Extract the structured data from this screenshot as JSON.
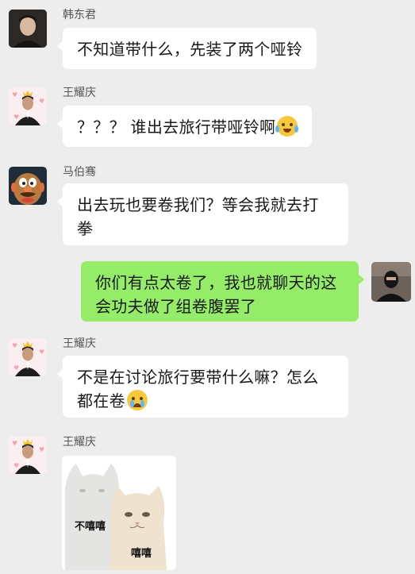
{
  "messages": [
    {
      "sender": "韩东君",
      "text": "不知道带什么，先装了两个哑铃",
      "avatar_icon": "man-portrait-avatar"
    },
    {
      "sender": "王耀庆",
      "text": "？？？ 谁出去旅行带哑铃啊",
      "emoji": "crying-laughing-emoji",
      "avatar_icon": "man-with-crown-avatar"
    },
    {
      "sender": "马伯骞",
      "line1": "出去玩也要卷我们？等会我就去打",
      "line2": "拳",
      "avatar_icon": "potato-head-avatar"
    },
    {
      "sender": "me",
      "line1": "你们有点太卷了，我也就聊天的这",
      "line2": "会功夫做了组卷腹罢了",
      "avatar_icon": "masked-person-avatar"
    },
    {
      "sender": "王耀庆",
      "line1": "不是在讨论旅行要带什么嘛？怎么",
      "line2": "都在卷",
      "emoji": "crying-emoji",
      "avatar_icon": "man-with-crown-avatar"
    },
    {
      "sender": "王耀庆",
      "sticker": {
        "caption_left": "不嘻嘻",
        "caption_right": "嘻嘻",
        "icon": "two-cats-sticker"
      },
      "avatar_icon": "man-with-crown-avatar"
    }
  ],
  "colors": {
    "background": "#ededed",
    "bubble_in": "#ffffff",
    "bubble_out": "#95ec69"
  }
}
